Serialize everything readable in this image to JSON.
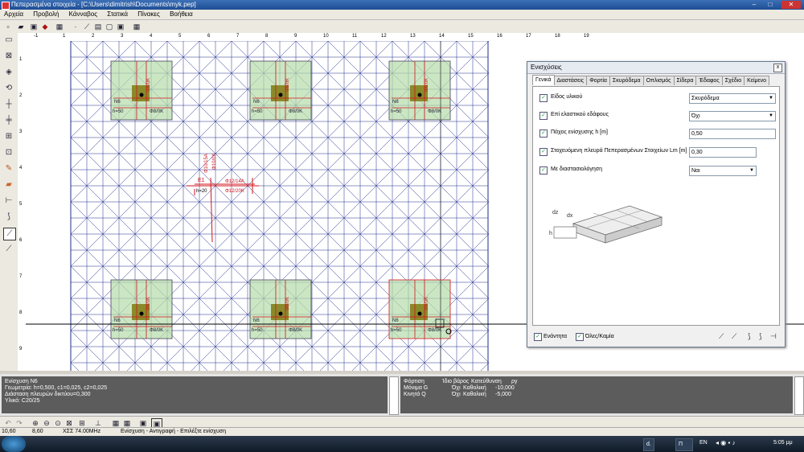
{
  "window": {
    "title": "Πεπερασμένα στοιχεία - [C:\\Users\\dimitrish\\Documents\\myk.pep]",
    "minimize": "–",
    "maximize": "□",
    "close": "✕"
  },
  "menu": [
    "Αρχεία",
    "Προβολή",
    "Κάνναβος",
    "Στατικά",
    "Πίνακες",
    "Βοήθεια"
  ],
  "ruler_ticks": [
    "-1",
    "1",
    "2",
    "3",
    "4",
    "5",
    "6",
    "7",
    "8",
    "9",
    "10",
    "11",
    "12",
    "13",
    "14",
    "15",
    "16",
    "17",
    "18",
    "19"
  ],
  "vruler_ticks": [
    "1",
    "2",
    "3",
    "4",
    "5",
    "6",
    "7",
    "8",
    "9"
  ],
  "drawing": {
    "footing_labels": {
      "name": "N6",
      "h": "h=50",
      "bar_a": "Φ8/0K",
      "bar_b": "Φ8/0K"
    },
    "slab": {
      "name": "E1",
      "h": "h=20",
      "bar1": "Φ10/15A",
      "bar2": "Φ10/0K",
      "bar3": "Φ12/14A",
      "bar4": "Φ12/20K"
    }
  },
  "dialog": {
    "title": "Ενισχύσεις",
    "close": "x",
    "tabs": [
      "Γενικά",
      "Διαστάσεις",
      "Φορτία",
      "Σκυρόδεμα",
      "Οπλισμός",
      "Σίδερα",
      "Έδαφος",
      "Σχέδιο",
      "Κείμενο"
    ],
    "active_tab": "Γενικά",
    "rows": [
      {
        "label": "Είδος υλικού",
        "value": "Σκυρόδεμα",
        "type": "select",
        "checked": true
      },
      {
        "label": "Επί ελαστικού εδάφους",
        "value": "Όχι",
        "type": "select",
        "checked": true
      },
      {
        "label": "Πάχος ενίσχυσης h [m]",
        "value": "0,50",
        "type": "input",
        "checked": true
      },
      {
        "label": "Στοχευόμενη πλευρά Πεπερασμένων Στοιχείων Lm [m]",
        "value": "0,30",
        "type": "input",
        "checked": true
      },
      {
        "label": "Με διαστασιολόγηση",
        "value": "Ναι",
        "type": "select",
        "checked": true
      }
    ],
    "figure_labels": {
      "dx": "dx",
      "dz": "dz",
      "h": "h"
    },
    "footer": {
      "visible_label": "Ενάντητα",
      "all_none_label": "Όλες/Καμία"
    }
  },
  "info_left": {
    "line1": "Ενίσχυση N6",
    "line2": "Γεωμετρία: h=0,500, c1=0,025, c2=0,025",
    "line3": "Διάσταση πλευρών δικτύου=0,300",
    "line4": "Υλικό: C20/25"
  },
  "info_right": {
    "header": [
      "Φόρτιση",
      "Ίδιο βάρος",
      "Κατεύθυνση",
      "ρy"
    ],
    "rows": [
      [
        "Μόνιμα G",
        "Όχι",
        "Καθολική",
        "-10,000"
      ],
      [
        "Κινητά Q",
        "Όχι",
        "Καθολική",
        "-5,000"
      ]
    ]
  },
  "status": {
    "x": "10,60",
    "y": "8,60",
    "clock_speed": "ΧΣΣ 74.00MHz",
    "message": "Ενίσχυση - Αντιγραφή - Επιλέξτε ενίσχυση"
  },
  "taskbar": {
    "task1": "d.",
    "task2": "Π",
    "lang": "EN",
    "time": "5:05 μμ"
  },
  "colors": {
    "mesh": "#1f2d8c",
    "footing_fill": "#b5dca8",
    "column_fill": "#8a8a2a",
    "rebar": "#d0161e",
    "panel_bg": "#5c5c5c"
  }
}
